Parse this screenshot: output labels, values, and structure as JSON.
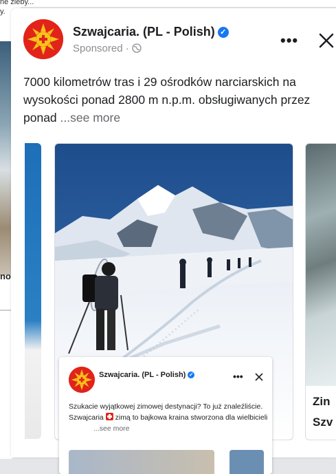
{
  "background_post": {
    "partial_text": "ne zieby...\ny.",
    "partial_caption": "no"
  },
  "ad": {
    "page_name": "Szwajcaria. (PL - Polish)",
    "sponsored": "Sponsored · ",
    "body": "7000 kilometrów tras i 29 ośrodków narciarskich na wysokości ponad 2800 m n.p.m. obsługiwanych przez ponad ",
    "see_more": "...see more"
  },
  "carousel": {
    "next_caption_line1": "Zin",
    "next_caption_line2": "Szv"
  },
  "mini_ad": {
    "page_name": "Szwajcaria. (PL - Polish)",
    "text_before_flag": "Szukacie wyjątkowej zimowej destynacji? To już znaleźliście. Szwajcaria ",
    "text_after_flag": " zimą to bajkowa kraina stworzona dla wielbicieli",
    "see_more": "...see more"
  },
  "colors": {
    "brand_red": "#e2231a",
    "verified_blue": "#1877f2",
    "secondary_text": "#65676b"
  }
}
